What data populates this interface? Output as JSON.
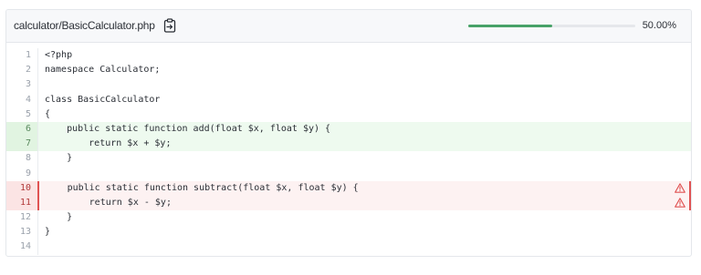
{
  "header": {
    "file_path": "calculator/BasicCalculator.php",
    "coverage_percent": "50.00%",
    "coverage_fraction": 0.5,
    "copy_icon": "clipboard-copy-icon"
  },
  "colors": {
    "covered_bg": "#eefaef",
    "uncovered_bg": "#fdf2f2",
    "progress": "#48a268",
    "warning": "#e05252"
  },
  "lines": [
    {
      "num": "1",
      "code": "<?php",
      "status": "none"
    },
    {
      "num": "2",
      "code": "namespace Calculator;",
      "status": "none"
    },
    {
      "num": "3",
      "code": "",
      "status": "none"
    },
    {
      "num": "4",
      "code": "class BasicCalculator",
      "status": "none"
    },
    {
      "num": "5",
      "code": "{",
      "status": "none"
    },
    {
      "num": "6",
      "code": "    public static function add(float $x, float $y) {",
      "status": "covered"
    },
    {
      "num": "7",
      "code": "        return $x + $y;",
      "status": "covered"
    },
    {
      "num": "8",
      "code": "    }",
      "status": "none"
    },
    {
      "num": "9",
      "code": "",
      "status": "none"
    },
    {
      "num": "10",
      "code": "    public static function subtract(float $x, float $y) {",
      "status": "uncovered"
    },
    {
      "num": "11",
      "code": "        return $x - $y;",
      "status": "uncovered"
    },
    {
      "num": "12",
      "code": "    }",
      "status": "none"
    },
    {
      "num": "13",
      "code": "}",
      "status": "none"
    },
    {
      "num": "14",
      "code": "",
      "status": "none"
    }
  ]
}
